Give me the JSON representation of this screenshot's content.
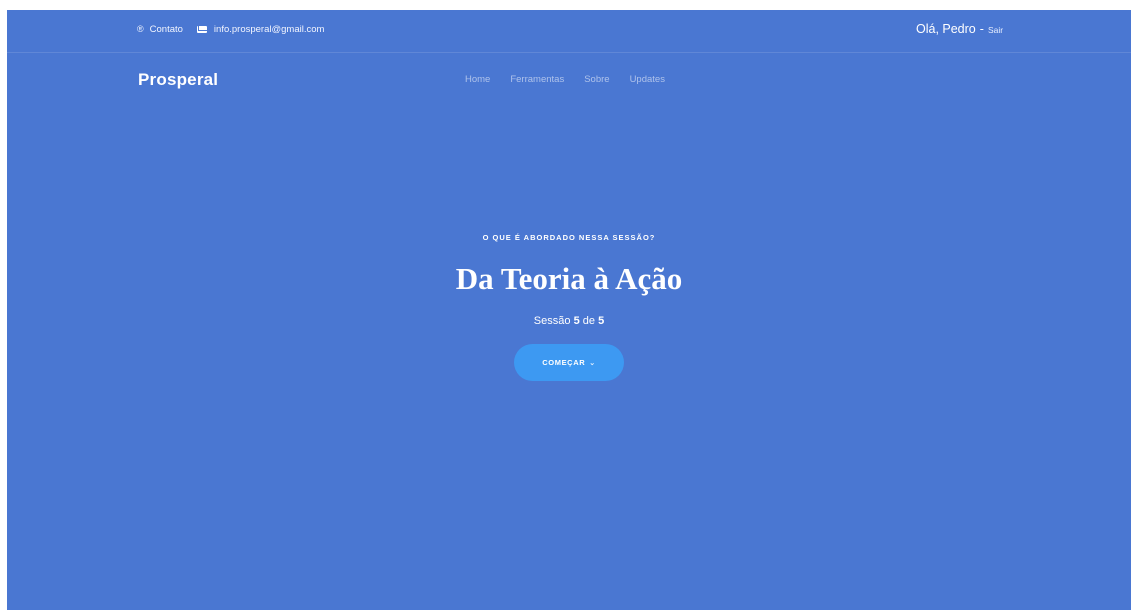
{
  "topbar": {
    "contact_label": "Contato",
    "email": "info.prosperal@gmail.com",
    "greeting": "Olá, Pedro",
    "separator": "-",
    "logout_label": "Sair"
  },
  "header": {
    "brand": "Prosperal",
    "nav": [
      "Home",
      "Ferramentas",
      "Sobre",
      "Updates"
    ]
  },
  "hero": {
    "eyebrow": "O QUE É ABORDADO NESSA SESSÃO?",
    "title": "Da Teoria à Ação",
    "session_prefix": "Sessão",
    "session_current": "5",
    "session_middle": "de",
    "session_total": "5",
    "cta_label": "COMEÇAR",
    "cta_icon": "chevron-down-icon"
  },
  "colors": {
    "background": "#4a77d2",
    "cta": "#3d99f2"
  }
}
